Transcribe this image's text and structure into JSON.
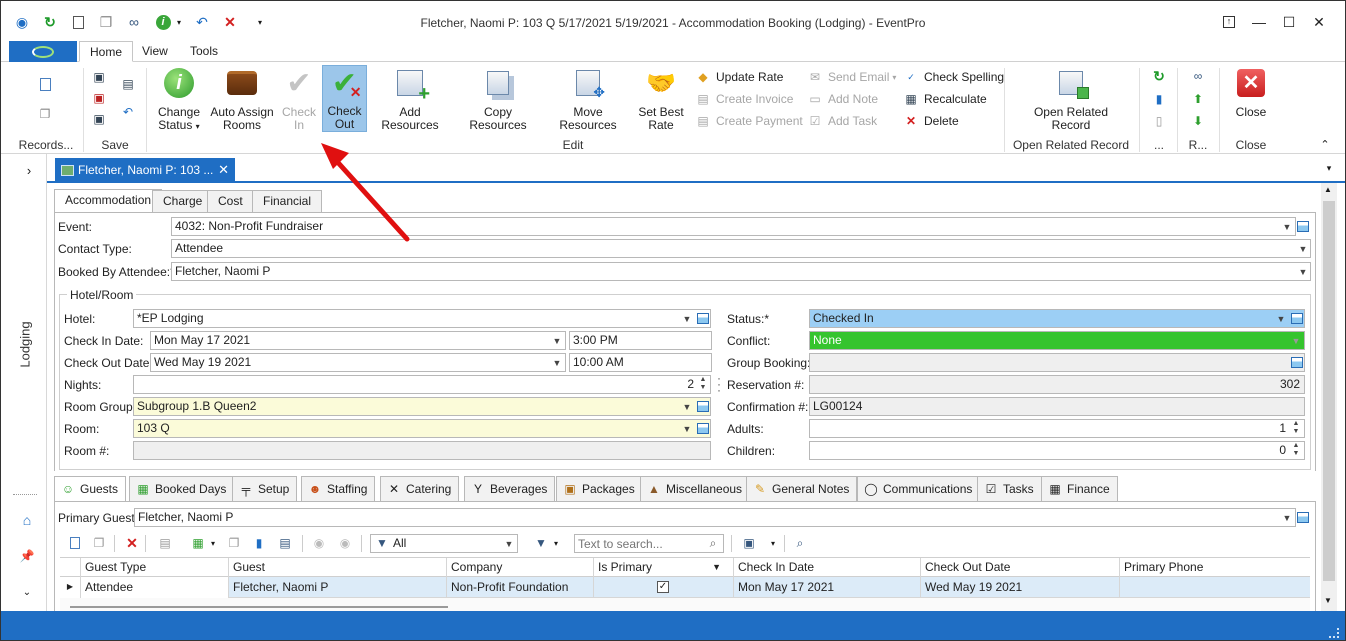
{
  "window": {
    "title": "Fletcher, Naomi P: 103 Q 5/17/2021 5/19/2021  - Accommodation Booking (Lodging) - EventPro"
  },
  "ribbon_tabs": [
    "Home",
    "View",
    "Tools"
  ],
  "ribbon": {
    "groups": {
      "records": "Records...",
      "save": "Save",
      "edit": "Edit",
      "open_related": "Open Related Record",
      "more": "...",
      "r": "R...",
      "close": "Close"
    },
    "change_status": {
      "line1": "Change",
      "line2": "Status"
    },
    "auto_assign": {
      "line1": "Auto Assign",
      "line2": "Rooms"
    },
    "check_in": {
      "line1": "Check",
      "line2": "In"
    },
    "check_out": {
      "line1": "Check",
      "line2": "Out"
    },
    "add_resources": "Add Resources",
    "copy_resources": "Copy Resources",
    "move_resources": "Move Resources",
    "set_best_rate": {
      "line1": "Set Best",
      "line2": "Rate"
    },
    "update_rate": "Update Rate",
    "create_invoice": "Create Invoice",
    "create_payment": "Create Payment",
    "send_email": "Send Email",
    "add_note": "Add Note",
    "add_task": "Add Task",
    "check_spelling": "Check Spelling",
    "recalculate": "Recalculate",
    "delete": "Delete",
    "open_related_record": {
      "line1": "Open Related",
      "line2": "Record"
    },
    "close": "Close"
  },
  "doc_tab": {
    "label": "Fletcher, Naomi P: 103 ..."
  },
  "side_label": "Lodging",
  "top_tabs": [
    "Accommodation",
    "Charge",
    "Cost",
    "Financial"
  ],
  "form": {
    "event": {
      "label": "Event:",
      "value": "4032: Non-Profit Fundraiser"
    },
    "contact_type": {
      "label": "Contact Type:",
      "value": "Attendee"
    },
    "booked_by": {
      "label": "Booked By Attendee:*",
      "value": "Fletcher, Naomi P"
    },
    "hotel_room_group": "Hotel/Room",
    "hotel": {
      "label": "Hotel:",
      "value": "*EP Lodging"
    },
    "check_in_date": {
      "label": "Check In Date:",
      "value": "Mon May 17 2021",
      "time": "3:00 PM"
    },
    "check_out_date": {
      "label": "Check Out Date:",
      "value": "Wed May 19 2021",
      "time": "10:00 AM"
    },
    "nights": {
      "label": "Nights:",
      "value": "2"
    },
    "room_group": {
      "label": "Room Group:",
      "value": "Subgroup 1.B Queen2"
    },
    "room": {
      "label": "Room:",
      "value": "103 Q"
    },
    "room_number": {
      "label": "Room #:",
      "value": ""
    },
    "status": {
      "label": "Status:*",
      "value": "Checked In",
      "color": "#9ccff5"
    },
    "conflict": {
      "label": "Conflict:",
      "value": "None",
      "color": "#35c42e"
    },
    "group_booking": {
      "label": "Group Booking:",
      "value": ""
    },
    "reservation": {
      "label": "Reservation #:",
      "value": "302"
    },
    "confirmation": {
      "label": "Confirmation #:",
      "value": "LG00124"
    },
    "adults": {
      "label": "Adults:",
      "value": "1"
    },
    "children": {
      "label": "Children:",
      "value": "0"
    }
  },
  "bottom_tabs": [
    "Guests",
    "Booked Days",
    "Setup",
    "Staffing",
    "Catering",
    "Beverages",
    "Packages",
    "Miscellaneous",
    "General Notes",
    "Communications",
    "Tasks",
    "Finance"
  ],
  "guests": {
    "primary_guest": {
      "label": "Primary Guest:",
      "value": "Fletcher, Naomi P"
    },
    "filter": "All",
    "search_placeholder": "Text to search...",
    "columns": [
      "Guest Type",
      "Guest",
      "Company",
      "Is Primary",
      "Check In Date",
      "Check Out Date",
      "Primary Phone"
    ],
    "rows": [
      {
        "guest_type": "Attendee",
        "guest": "Fletcher, Naomi P",
        "company": "Non-Profit Foundation",
        "is_primary": true,
        "check_in": "Mon May 17 2021",
        "check_out": "Wed May 19 2021",
        "phone": ""
      }
    ]
  }
}
